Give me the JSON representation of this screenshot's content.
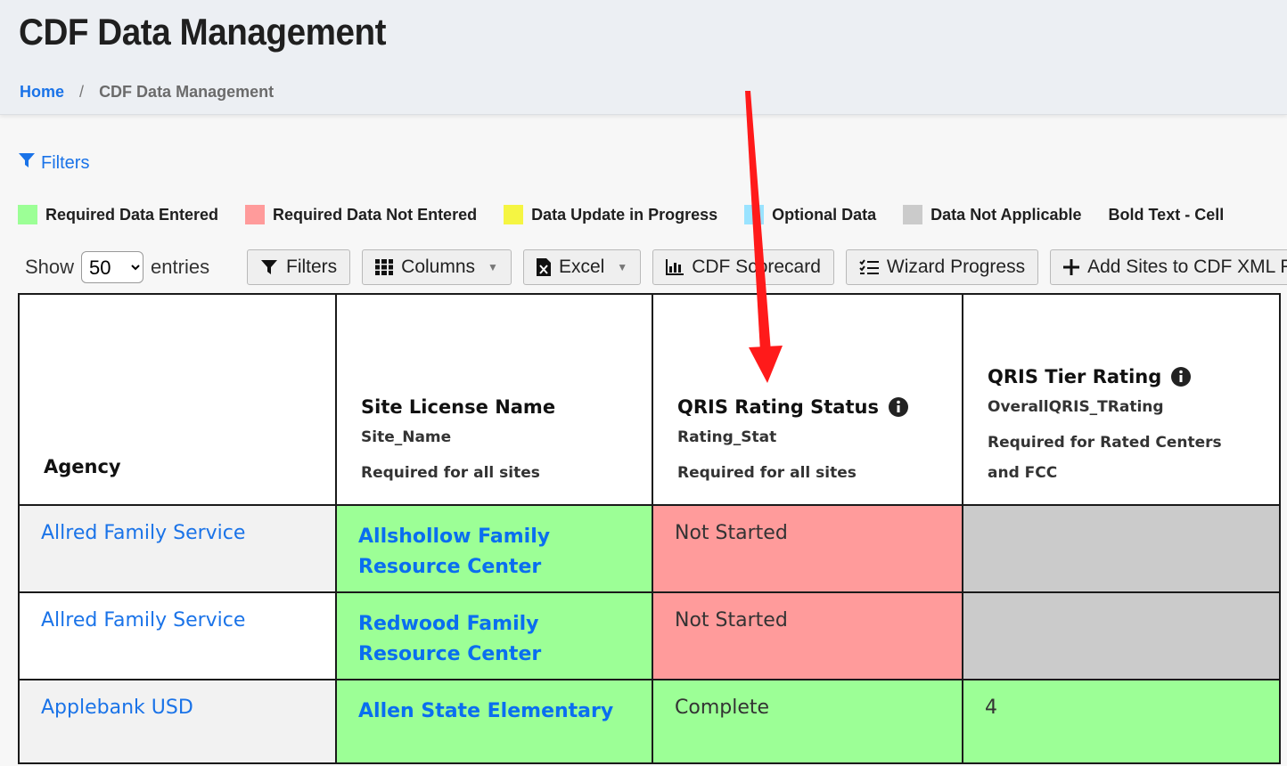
{
  "header": {
    "title": "CDF Data Management",
    "breadcrumb": {
      "home": "Home",
      "separator": "/",
      "current": "CDF Data Management"
    }
  },
  "filters_link": "Filters",
  "legend": [
    {
      "label": "Required Data Entered",
      "color": "#9cff96"
    },
    {
      "label": "Required Data Not Entered",
      "color": "#ff9b9b"
    },
    {
      "label": "Data Update in Progress",
      "color": "#f5f542"
    },
    {
      "label": "Optional Data",
      "color": "#9ae3ff"
    },
    {
      "label": "Data Not Applicable",
      "color": "#cbcbcb"
    }
  ],
  "legend_bold_note": "Bold Text - Cell",
  "show_entries": {
    "prefix": "Show",
    "value": "50",
    "suffix": "entries"
  },
  "toolbar": {
    "filters": "Filters",
    "columns": "Columns",
    "excel": "Excel",
    "scorecard": "CDF Scorecard",
    "wizard": "Wizard Progress",
    "add_sites": "Add Sites to CDF XML Re"
  },
  "columns": [
    {
      "title": "Agency",
      "field": "",
      "requirement": ""
    },
    {
      "title": "Site License Name",
      "field": "Site_Name",
      "requirement": "Required for all sites"
    },
    {
      "title": "QRIS Rating Status",
      "field": "Rating_Stat",
      "requirement": "Required for all sites"
    },
    {
      "title": "QRIS Tier Rating",
      "field": "OverallQRIS_TRating",
      "requirement": "Required for Rated Centers and FCC"
    }
  ],
  "rows": [
    {
      "agency": "Allred Family Service",
      "site": "Allshollow Family Resource Center",
      "status": "Not Started",
      "tier": ""
    },
    {
      "agency": "Allred Family Service",
      "site": "Redwood Family Resource Center",
      "status": "Not Started",
      "tier": ""
    },
    {
      "agency": "Applebank USD",
      "site": "Allen State Elementary",
      "status": "Complete",
      "tier": "4"
    }
  ],
  "colors": {
    "link": "#1a73e8",
    "annotation_arrow": "#ff0000"
  }
}
